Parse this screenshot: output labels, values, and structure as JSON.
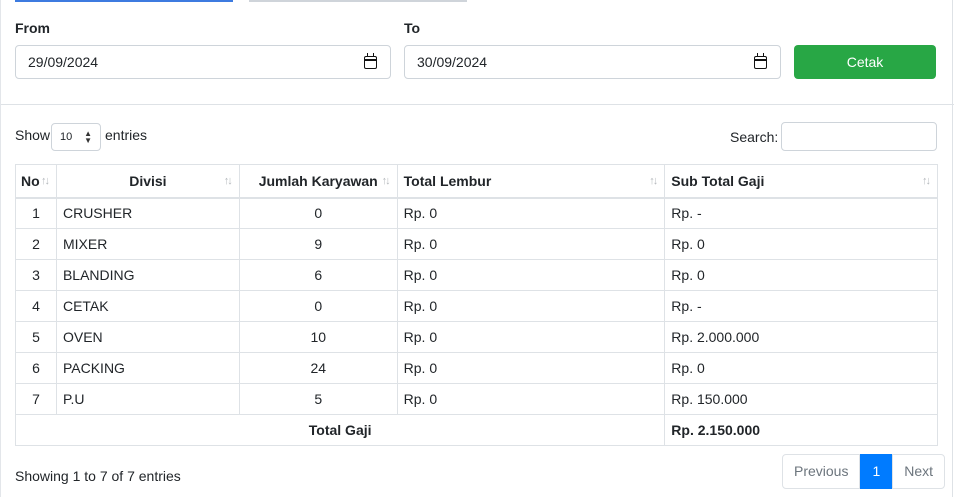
{
  "filters": {
    "from_label": "From",
    "from_value": "29/09/2024",
    "to_label": "To",
    "to_value": "30/09/2024",
    "print_button": "Cetak",
    "print_button_color": "#28a745"
  },
  "table_controls": {
    "show_label": "Show",
    "length_value": "10",
    "entries_label": "entries",
    "search_label": "Search:",
    "search_value": ""
  },
  "table": {
    "columns": [
      "No",
      "Divisi",
      "Jumlah Karyawan",
      "Total Lembur",
      "Sub Total Gaji"
    ],
    "rows": [
      [
        "1",
        "CRUSHER",
        "0",
        "Rp. 0",
        "Rp. -"
      ],
      [
        "2",
        "MIXER",
        "9",
        "Rp. 0",
        "Rp. 0"
      ],
      [
        "3",
        "BLANDING",
        "6",
        "Rp. 0",
        "Rp. 0"
      ],
      [
        "4",
        "CETAK",
        "0",
        "Rp. 0",
        "Rp. -"
      ],
      [
        "5",
        "OVEN",
        "10",
        "Rp. 0",
        "Rp. 2.000.000"
      ],
      [
        "6",
        "PACKING",
        "24",
        "Rp. 0",
        "Rp. 0"
      ],
      [
        "7",
        "P.U",
        "5",
        "Rp. 0",
        "Rp. 150.000"
      ]
    ],
    "footer_label": "Total Gaji",
    "footer_value": "Rp. 2.150.000"
  },
  "pagination": {
    "info": "Showing 1 to 7 of 7 entries",
    "previous": "Previous",
    "current_page": "1",
    "next": "Next",
    "active_color": "#007bff"
  }
}
